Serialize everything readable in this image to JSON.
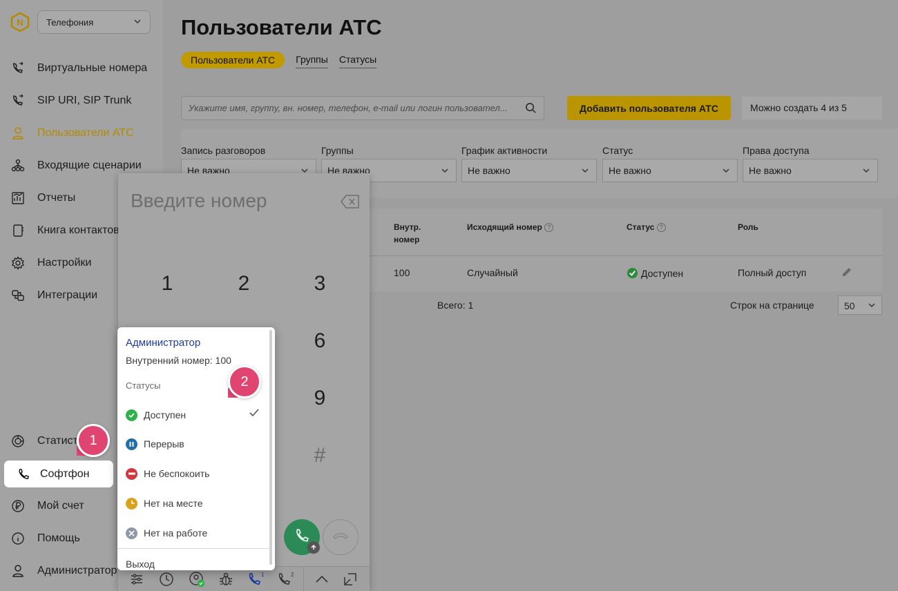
{
  "sidebar": {
    "product_select": "Телефония",
    "items": [
      {
        "label": "Виртуальные номера",
        "icon": "phone-forward-icon"
      },
      {
        "label": "SIP URI, SIP Trunk",
        "icon": "phone-forward-icon"
      },
      {
        "label": "Пользователи АТС",
        "icon": "user-icon",
        "active": true
      },
      {
        "label": "Входящие сценарии",
        "icon": "flow-icon"
      },
      {
        "label": "Отчеты",
        "icon": "report-icon"
      },
      {
        "label": "Книга контактов",
        "icon": "contacts-book-icon"
      },
      {
        "label": "Настройки",
        "icon": "gear-icon"
      },
      {
        "label": "Интеграции",
        "icon": "integrations-icon"
      },
      {
        "label": "Статистика",
        "icon": "stats-icon"
      },
      {
        "label": "Софтфон",
        "icon": "phone-icon"
      },
      {
        "label": "Мой счет",
        "icon": "ruble-icon"
      },
      {
        "label": "Помощь",
        "icon": "info-icon"
      },
      {
        "label": "Администратор",
        "icon": "user-icon"
      }
    ],
    "stats_label_visible": "Статист"
  },
  "main": {
    "title": "Пользователи АТС",
    "tabs": [
      {
        "label": "Пользователи АТС",
        "active": true
      },
      {
        "label": "Группы"
      },
      {
        "label": "Статусы"
      }
    ],
    "search_placeholder": "Укажите имя, группу, вн. номер, телефон, e-mail или логин пользовател...",
    "add_button": "Добавить пользователя АТС",
    "limit_note": "Можно создать 4 из 5",
    "filters": [
      {
        "label": "Запись разговоров",
        "value": "Не важно"
      },
      {
        "label": "Группы",
        "value": "Не важно"
      },
      {
        "label": "График активности",
        "value": "Не важно"
      },
      {
        "label": "Статус",
        "value": "Не важно"
      },
      {
        "label": "Права доступа",
        "value": "Не важно"
      }
    ],
    "table": {
      "headers": {
        "ext_line1": "Внутр.",
        "ext_line2": "номер",
        "outgoing": "Исходящий номер",
        "status": "Статус",
        "role": "Роль"
      },
      "row": {
        "ext": "100",
        "outgoing": "Случайный",
        "status": "Доступен",
        "role": "Полный доступ"
      },
      "total": "Всего: 1",
      "rows_per_page_label": "Строк на странице",
      "rows_per_page": "50"
    }
  },
  "softphone": {
    "placeholder": "Введите номер",
    "keys": [
      "1",
      "2",
      "3",
      "6",
      "9",
      "#"
    ],
    "toolbar_line1_badge": "1",
    "toolbar_line2_badge": "2"
  },
  "status_menu": {
    "user_name": "Администратор",
    "extension": "Внутренний номер: 100",
    "section": "Статусы",
    "items": [
      {
        "label": "Доступен",
        "color": "#2fb14a",
        "selected": true
      },
      {
        "label": "Перерыв",
        "color": "#1f6fa8"
      },
      {
        "label": "Не беспокоить",
        "color": "#d0383e"
      },
      {
        "label": "Нет на месте",
        "color": "#d9a21b"
      },
      {
        "label": "Нет на работе",
        "color": "#8d99a6"
      }
    ],
    "logout": "Выход"
  },
  "markers": [
    "1",
    "2"
  ],
  "colors": {
    "accent": "#f2c200",
    "marker": "#e04572",
    "call_green": "#2b8a55"
  }
}
